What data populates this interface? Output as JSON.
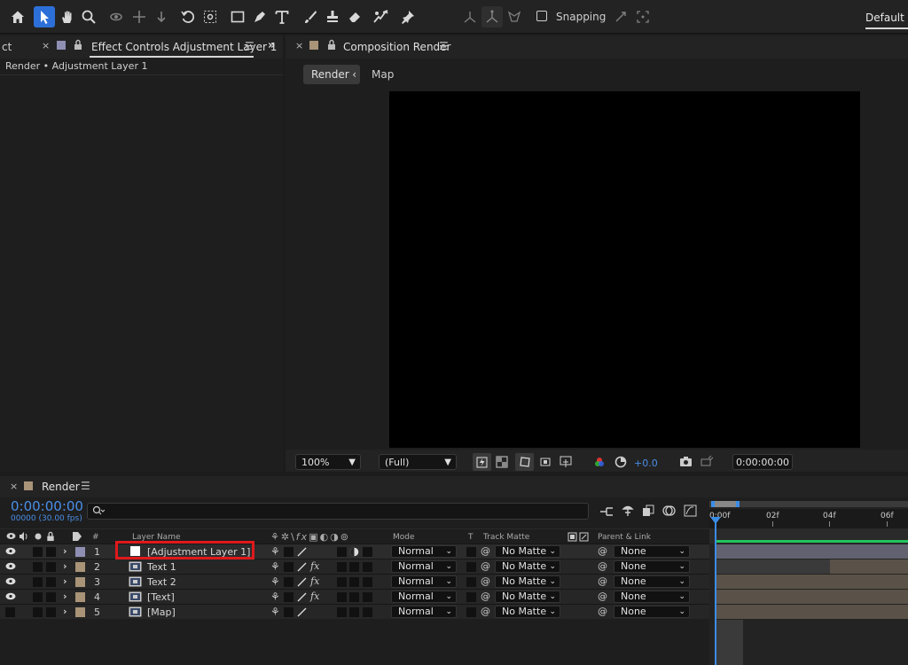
{
  "toolbar": {
    "snapping_label": "Snapping",
    "workspace_label": "Default",
    "accent_color": "#2d6fd8"
  },
  "left_panel": {
    "prev_tab_label": "ct",
    "tab_label": "Effect Controls Adjustment Layer 1",
    "breadcrumb": "Render • Adjustment Layer 1"
  },
  "composition_panel": {
    "tab_label": "Composition Render",
    "breadcrumb": {
      "active": "Render",
      "next": "Map"
    },
    "footer": {
      "zoom": "100%",
      "resolution": "(Full)",
      "exposure": "+0.0",
      "timecode": "0:00:00:00"
    }
  },
  "timeline": {
    "tab_label": "Render",
    "current_time": "0:00:00:00",
    "frame_info": "00000 (30.00 fps)",
    "search_placeholder": "",
    "ruler": [
      "0:00f",
      "02f",
      "04f",
      "06f"
    ],
    "columns": {
      "hash": "#",
      "layer_name": "Layer Name",
      "mode": "Mode",
      "t": "T",
      "track_matte": "Track Matte",
      "parent_link": "Parent & Link"
    },
    "layers": [
      {
        "num": "1",
        "name": "[Adjustment Layer 1]",
        "mode": "Normal",
        "matte": "No Matte",
        "parent": "None",
        "label_color": "#8f8fb4",
        "icon": "adjustment-layer-icon",
        "has_fx": false,
        "selected": true
      },
      {
        "num": "2",
        "name": "Text 1",
        "mode": "Normal",
        "matte": "No Matte",
        "parent": "None",
        "label_color": "#a99478",
        "icon": "comp-footage-icon",
        "has_fx": true,
        "selected": false
      },
      {
        "num": "3",
        "name": "Text 2",
        "mode": "Normal",
        "matte": "No Matte",
        "parent": "None",
        "label_color": "#a99478",
        "icon": "comp-footage-icon",
        "has_fx": true,
        "selected": false
      },
      {
        "num": "4",
        "name": "[Text]",
        "mode": "Normal",
        "matte": "No Matte",
        "parent": "None",
        "label_color": "#a99478",
        "icon": "comp-footage-icon",
        "has_fx": true,
        "selected": false
      },
      {
        "num": "5",
        "name": "[Map]",
        "mode": "Normal",
        "matte": "No Matte",
        "parent": "None",
        "label_color": "#a99478",
        "icon": "comp-footage-icon",
        "has_fx": false,
        "selected": false
      }
    ],
    "fx_symbol": "fx",
    "highlight_color": "#e0191c",
    "playhead_color": "#3b8de6"
  }
}
